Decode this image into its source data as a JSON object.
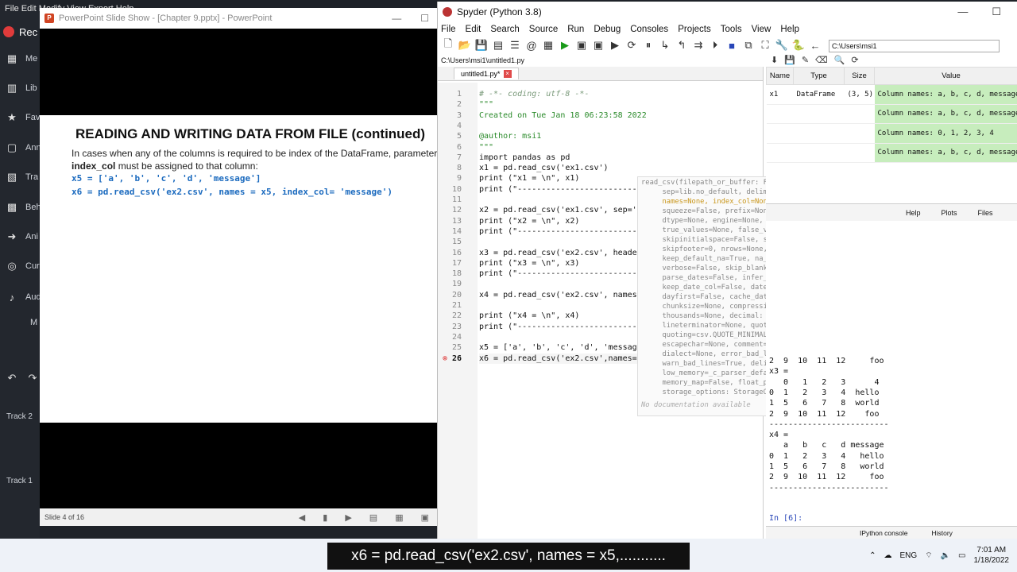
{
  "recorder": {
    "menu": "File  Edit  Modify  View  Export  Help",
    "record_label": "Rec",
    "sidebar_items": [
      {
        "label": "Me",
        "icon": "media-icon"
      },
      {
        "label": "Lib",
        "icon": "library-icon"
      },
      {
        "label": "Fav",
        "icon": "favorites-icon"
      },
      {
        "label": "Ann",
        "icon": "annotations-icon"
      },
      {
        "label": "Tra",
        "icon": "transitions-icon"
      },
      {
        "label": "Beh",
        "icon": "behaviors-icon"
      },
      {
        "label": "Ani",
        "icon": "animations-icon"
      },
      {
        "label": "Cur",
        "icon": "cursor-icon"
      },
      {
        "label": "Aud",
        "icon": "audio-icon"
      }
    ],
    "more_label": "M",
    "track2": "Track 2",
    "track1": "Track 1"
  },
  "ppt": {
    "title": "PowerPoint Slide Show - [Chapter 9.pptx] - PowerPoint",
    "slide_title": "READING AND WRITING DATA FROM FILE (continued)",
    "para_before": "In cases when any of the columns is required to be index of the DataFrame, parameter ",
    "para_bold": "index_col",
    "para_after": " must be assigned to that column:",
    "code1": "x5 = ['a', 'b', 'c', 'd', 'message']",
    "code2": "x6 = pd.read_csv('ex2.csv', names = x5, index_col= 'message')",
    "status": "Slide 4 of 16"
  },
  "spyder": {
    "title": "Spyder (Python 3.8)",
    "menu": [
      "File",
      "Edit",
      "Search",
      "Source",
      "Run",
      "Debug",
      "Consoles",
      "Projects",
      "Tools",
      "View",
      "Help"
    ],
    "path_value": "C:\\Users\\msi1",
    "file_path": "C:\\Users\\msi1\\untitled1.py",
    "tab_label": "untitled1.py*",
    "lines": [
      {
        "n": "1",
        "t": "# -*- coding: utf-8 -*-",
        "c": "cm"
      },
      {
        "n": "2",
        "t": "\"\"\"",
        "c": "st"
      },
      {
        "n": "3",
        "t": "Created on Tue Jan 18 06:23:58 2022",
        "c": "st"
      },
      {
        "n": "4",
        "t": "",
        "c": ""
      },
      {
        "n": "5",
        "t": "@author: msi1",
        "c": "st"
      },
      {
        "n": "6",
        "t": "\"\"\"",
        "c": "st"
      },
      {
        "n": "7",
        "t": "import pandas as pd",
        "c": ""
      },
      {
        "n": "8",
        "t": "x1 = pd.read_csv('ex1.csv')",
        "c": ""
      },
      {
        "n": "9",
        "t": "print (\"x1 = \\n\", x1)",
        "c": ""
      },
      {
        "n": "10",
        "t": "print (\"-------------------------\"",
        "c": ""
      },
      {
        "n": "11",
        "t": "",
        "c": ""
      },
      {
        "n": "12",
        "t": "x2 = pd.read_csv('ex1.csv', sep='",
        "c": ""
      },
      {
        "n": "13",
        "t": "print (\"x2 = \\n\", x2)",
        "c": ""
      },
      {
        "n": "14",
        "t": "print (\"-------------------------\"",
        "c": ""
      },
      {
        "n": "15",
        "t": "",
        "c": ""
      },
      {
        "n": "16",
        "t": "x3 = pd.read_csv('ex2.csv', heade",
        "c": ""
      },
      {
        "n": "17",
        "t": "print (\"x3 = \\n\", x3)",
        "c": ""
      },
      {
        "n": "18",
        "t": "print (\"-------------------------\"",
        "c": ""
      },
      {
        "n": "19",
        "t": "",
        "c": ""
      },
      {
        "n": "20",
        "t": "x4 = pd.read_csv('ex2.csv', names",
        "c": ""
      },
      {
        "n": "21",
        "t": "",
        "c": ""
      },
      {
        "n": "22",
        "t": "print (\"x4 = \\n\", x4)",
        "c": ""
      },
      {
        "n": "23",
        "t": "print (\"-------------------------\"",
        "c": ""
      },
      {
        "n": "24",
        "t": "",
        "c": ""
      },
      {
        "n": "25",
        "t": "x5 = ['a', 'b', 'c', 'd', 'messag",
        "c": ""
      },
      {
        "n": "26",
        "t": "x6 = pd.read_csv('ex2.csv',names=x5)",
        "c": ""
      }
    ],
    "popup_lines": [
      "read_csv(filepath_or_buffer: FilePathOrBuffer,",
      "     sep=lib.no_default, delimiter=None, header=\"infer\",",
      "     names=None, index_col=None, usecols=None,",
      "     squeeze=False, prefix=None, mangle_dupe_cols=True,",
      "     dtype=None, engine=None, converters=None,",
      "     true_values=None, false_values=None,",
      "     skipinitialspace=False, skiprows=None,",
      "     skipfooter=0, nrows=None, na_values=None,",
      "     keep_default_na=True, na_filter=True,",
      "     verbose=False, skip_blank_lines=True,",
      "     parse_dates=False, infer_datetime_format=False,",
      "     keep_date_col=False, date_parser=None,",
      "     dayfirst=False, cache_dates=True, iterator=False,",
      "     chunksize=None, compression=\"infer\",",
      "     thousands=None, decimal: str=\".\",",
      "     lineterminator=None, quotechar='\"',",
      "     quoting=csv.QUOTE_MINIMAL, doublequote=True,",
      "     escapechar=None, comment=None, encoding=None,",
      "     dialect=None, error_bad_lines=True,",
      "     warn_bad_lines=True, delim_whitespace=False,",
      "     low_memory=_c_parser_defaults[\"low_memory\"],",
      "     memory_map=False, float_precision=None,",
      "     storage_options: StorageOptions=None)"
    ],
    "popup_nodoc": "No documentation available",
    "var_headers": [
      "Name",
      "Type",
      "Size",
      "Value"
    ],
    "vars": [
      {
        "name": "x1",
        "type": "DataFrame",
        "size": "(3, 5)",
        "value": "Column names: a, b, c, d, message"
      },
      {
        "name": "",
        "type": "",
        "size": "",
        "value": "Column names: a, b, c, d, message"
      },
      {
        "name": "",
        "type": "",
        "size": "",
        "value": "Column names: 0, 1, 2, 3, 4"
      },
      {
        "name": "",
        "type": "",
        "size": "",
        "value": "Column names: a, b, c, d, message"
      }
    ],
    "pane_tabs": [
      "Help",
      "Plots",
      "Files"
    ],
    "console_lines": [
      "2  9  10  11  12     foo",
      "x3 =",
      "   0   1   2   3      4",
      "0  1   2   3   4  hello",
      "1  5   6   7   8  world",
      "2  9  10  11  12    foo",
      "-------------------------",
      "x4 =",
      "   a   b   c   d message",
      "0  1   2   3   4   hello",
      "1  5   6   7   8   world",
      "2  9  10  11  12     foo",
      "-------------------------"
    ],
    "prompt": "In [6]:",
    "bottom_tabs": [
      "IPython console",
      "History"
    ]
  },
  "taskbar": {
    "lang": "ENG",
    "time": "7:01 AM",
    "date": "1/18/2022"
  },
  "caption": "x6 = pd.read_csv('ex2.csv', names = x5,..........."
}
